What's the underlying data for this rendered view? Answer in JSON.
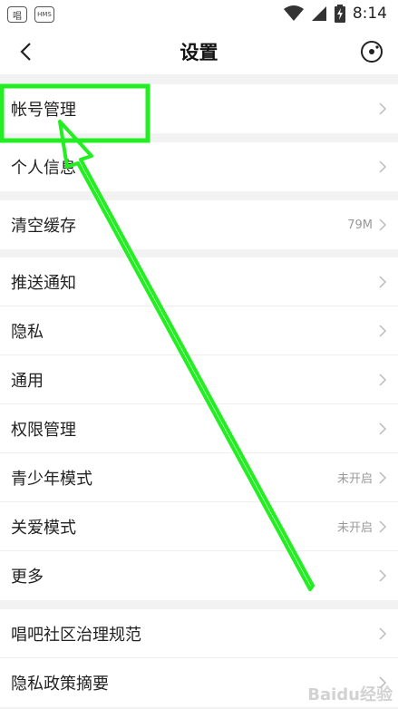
{
  "status_bar": {
    "app_icon_1": "唱",
    "app_icon_2": "HMS",
    "time": "8:14"
  },
  "nav": {
    "title": "设置"
  },
  "groups": [
    {
      "items": [
        {
          "label": "帐号管理",
          "value": ""
        }
      ]
    },
    {
      "items": [
        {
          "label": "个人信息",
          "value": ""
        }
      ]
    },
    {
      "items": [
        {
          "label": "清空缓存",
          "value": "79M"
        }
      ]
    },
    {
      "items": [
        {
          "label": "推送通知",
          "value": ""
        },
        {
          "label": "隐私",
          "value": ""
        },
        {
          "label": "通用",
          "value": ""
        },
        {
          "label": "权限管理",
          "value": ""
        },
        {
          "label": "青少年模式",
          "value": "未开启"
        },
        {
          "label": "关爱模式",
          "value": "未开启"
        },
        {
          "label": "更多",
          "value": ""
        }
      ]
    },
    {
      "items": [
        {
          "label": "唱吧社区治理规范",
          "value": ""
        },
        {
          "label": "隐私政策摘要",
          "value": ""
        }
      ]
    }
  ],
  "annotation": {
    "color": "#22ee22"
  },
  "watermark": "Baidu经验"
}
